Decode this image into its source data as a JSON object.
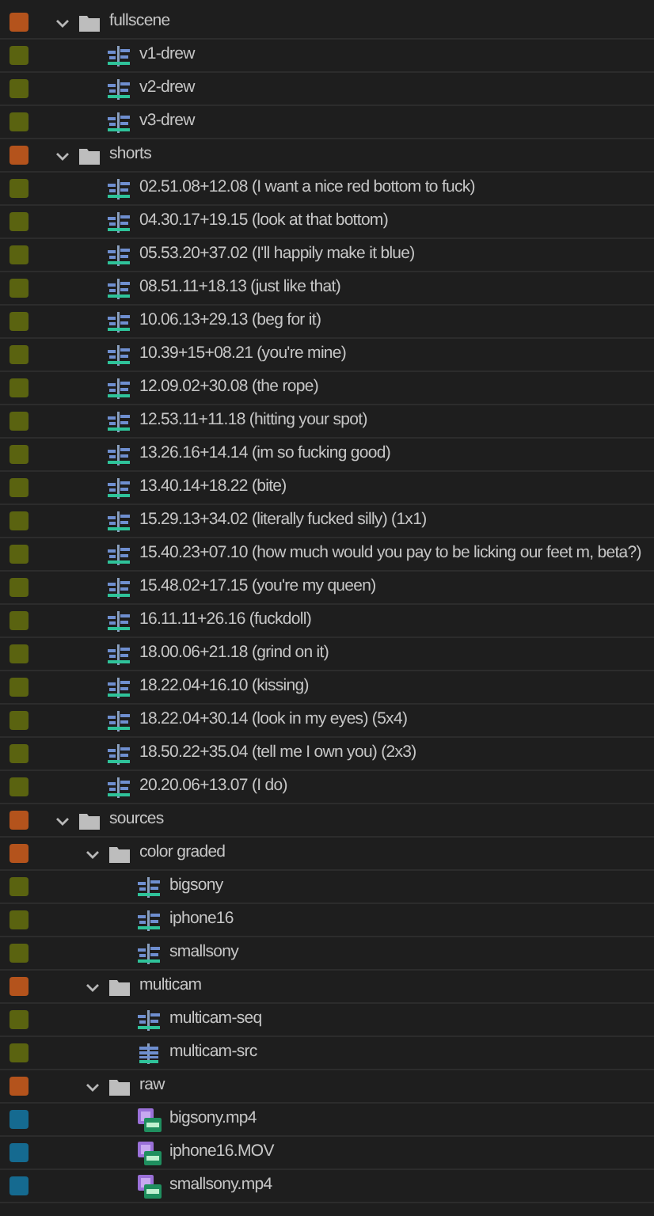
{
  "items": [
    {
      "name": "fullscene",
      "kind": "folder",
      "color": "#b4531c",
      "expanded": true,
      "children": [
        {
          "name": "v1-drew",
          "kind": "sequence",
          "color": "#5a6310"
        },
        {
          "name": "v2-drew",
          "kind": "sequence",
          "color": "#5a6310"
        },
        {
          "name": "v3-drew",
          "kind": "sequence",
          "color": "#5a6310"
        }
      ]
    },
    {
      "name": "shorts",
      "kind": "folder",
      "color": "#b4531c",
      "expanded": true,
      "children": [
        {
          "name": "02.51.08+12.08 (I want a nice red bottom to fuck)",
          "kind": "sequence",
          "color": "#5a6310"
        },
        {
          "name": "04.30.17+19.15 (look at that bottom)",
          "kind": "sequence",
          "color": "#5a6310"
        },
        {
          "name": "05.53.20+37.02 (I'll happily make it blue)",
          "kind": "sequence",
          "color": "#5a6310"
        },
        {
          "name": "08.51.11+18.13 (just like that)",
          "kind": "sequence",
          "color": "#5a6310"
        },
        {
          "name": "10.06.13+29.13 (beg for it)",
          "kind": "sequence",
          "color": "#5a6310"
        },
        {
          "name": "10.39+15+08.21 (you're mine)",
          "kind": "sequence",
          "color": "#5a6310"
        },
        {
          "name": "12.09.02+30.08 (the rope)",
          "kind": "sequence",
          "color": "#5a6310"
        },
        {
          "name": "12.53.11+11.18 (hitting your spot)",
          "kind": "sequence",
          "color": "#5a6310"
        },
        {
          "name": "13.26.16+14.14 (im so fucking good)",
          "kind": "sequence",
          "color": "#5a6310"
        },
        {
          "name": "13.40.14+18.22 (bite)",
          "kind": "sequence",
          "color": "#5a6310"
        },
        {
          "name": "15.29.13+34.02 (literally fucked silly) (1x1)",
          "kind": "sequence",
          "color": "#5a6310"
        },
        {
          "name": "15.40.23+07.10 (how much would you pay to be licking our feet m, beta?)",
          "kind": "sequence",
          "color": "#5a6310"
        },
        {
          "name": "15.48.02+17.15 (you're my queen)",
          "kind": "sequence",
          "color": "#5a6310"
        },
        {
          "name": "16.11.11+26.16 (fuckdoll)",
          "kind": "sequence",
          "color": "#5a6310"
        },
        {
          "name": "18.00.06+21.18 (grind on it)",
          "kind": "sequence",
          "color": "#5a6310"
        },
        {
          "name": "18.22.04+16.10 (kissing)",
          "kind": "sequence",
          "color": "#5a6310"
        },
        {
          "name": "18.22.04+30.14 (look in my eyes) (5x4)",
          "kind": "sequence",
          "color": "#5a6310"
        },
        {
          "name": "18.50.22+35.04 (tell me I own you) (2x3)",
          "kind": "sequence",
          "color": "#5a6310"
        },
        {
          "name": "20.20.06+13.07 (I do)",
          "kind": "sequence",
          "color": "#5a6310"
        }
      ]
    },
    {
      "name": "sources",
      "kind": "folder",
      "color": "#b4531c",
      "expanded": true,
      "children": [
        {
          "name": "color graded",
          "kind": "folder",
          "color": "#b4531c",
          "expanded": true,
          "children": [
            {
              "name": "bigsony",
              "kind": "sequence",
              "color": "#5a6310"
            },
            {
              "name": "iphone16",
              "kind": "sequence",
              "color": "#5a6310"
            },
            {
              "name": "smallsony",
              "kind": "sequence",
              "color": "#5a6310"
            }
          ]
        },
        {
          "name": "multicam",
          "kind": "folder",
          "color": "#b4531c",
          "expanded": true,
          "children": [
            {
              "name": "multicam-seq",
              "kind": "sequence",
              "color": "#5a6310"
            },
            {
              "name": "multicam-src",
              "kind": "multicam",
              "color": "#5a6310"
            }
          ]
        },
        {
          "name": "raw",
          "kind": "folder",
          "color": "#b4531c",
          "expanded": true,
          "children": [
            {
              "name": "bigsony.mp4",
              "kind": "clip",
              "color": "#156a90"
            },
            {
              "name": "iphone16.MOV",
              "kind": "clip",
              "color": "#156a90"
            },
            {
              "name": "smallsony.mp4",
              "kind": "clip",
              "color": "#156a90"
            }
          ]
        }
      ]
    }
  ]
}
